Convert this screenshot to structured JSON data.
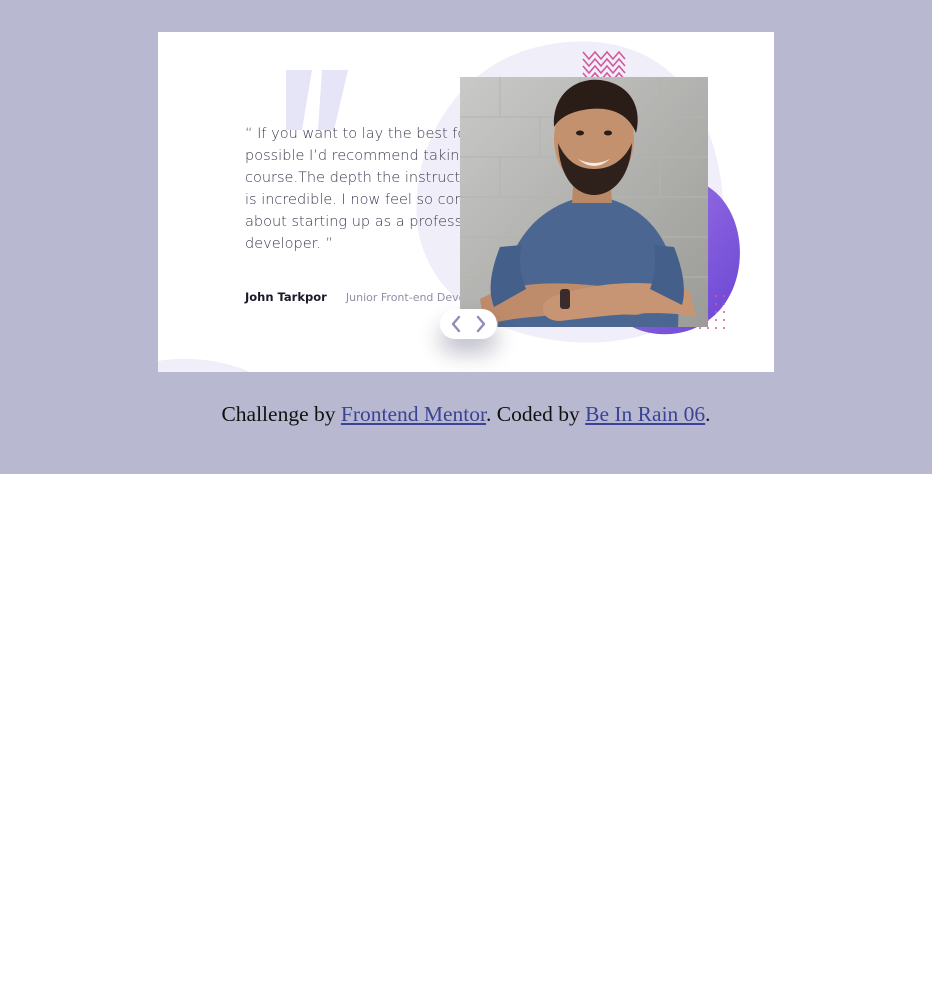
{
  "testimonial": {
    "quote": "“ If you want to lay the best foundation possible I’d recommend taking this course.The depth the instructors go into is incredible. I now feel so confident about starting up as a professional developer. ”",
    "author_name": "John Tarkpor",
    "author_role": "Junior Front-end Developer",
    "photo_description": "Smiling bearded man in blue t-shirt, arms crossed, against a grey brick wall",
    "nav": {
      "prev_icon": "chevron-left-icon",
      "next_icon": "chevron-right-icon"
    }
  },
  "footer": {
    "prefix": "Challenge by ",
    "link1": "Frontend Mentor",
    "middle": ". Coded by ",
    "link2": "Be In Rain 06",
    "suffix": "."
  },
  "colors": {
    "page_band": "#b8b9d0",
    "card": "#ffffff",
    "quote_mark": "#e6e4f7",
    "blob_light": "#efeef9",
    "blob_purple": "#8b63dd",
    "zigzag": "#d25a9c",
    "link": "#3b4396",
    "chevron": "#8d8db8"
  }
}
